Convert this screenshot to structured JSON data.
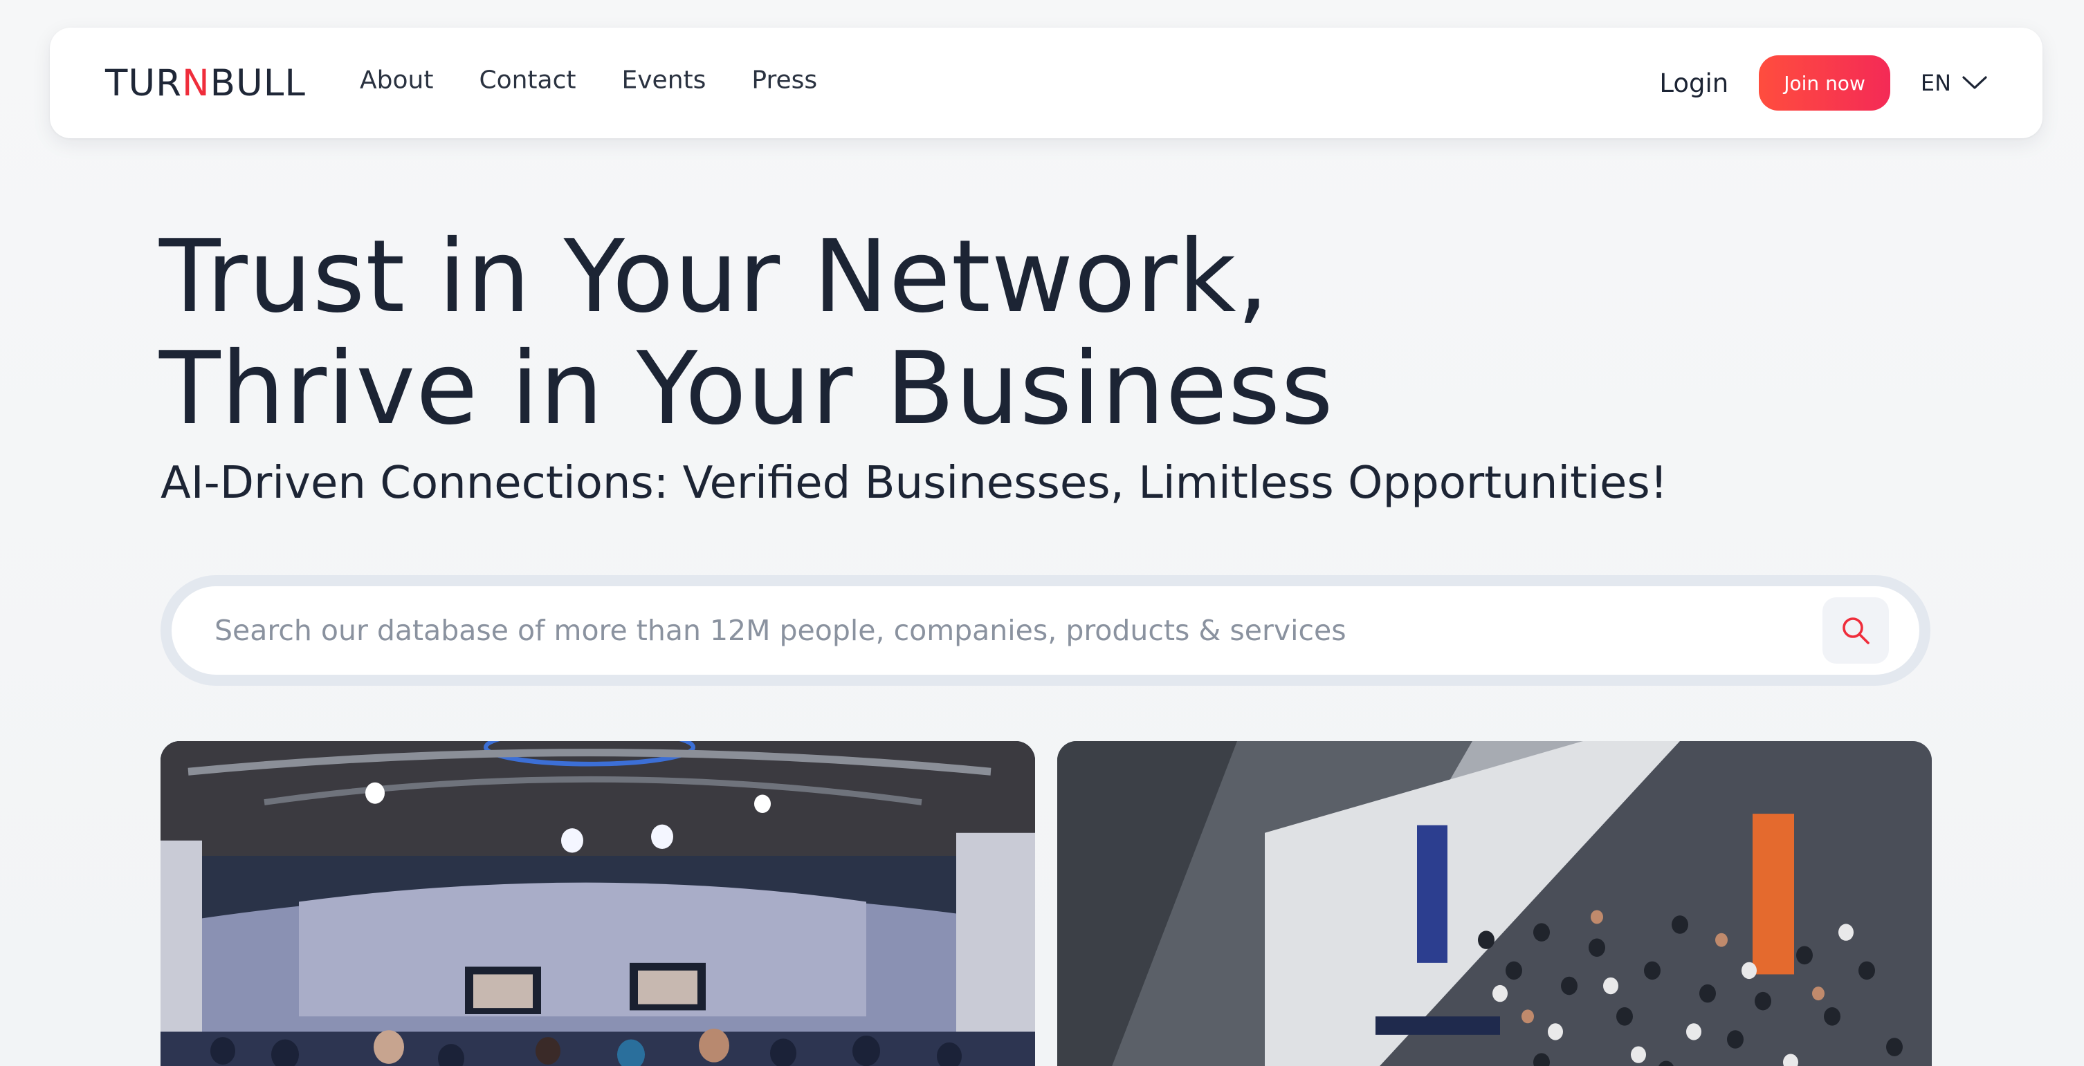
{
  "header": {
    "logo": {
      "part1": "TUR",
      "accent": "N",
      "part2": "BULL"
    },
    "nav": [
      {
        "label": "About"
      },
      {
        "label": "Contact"
      },
      {
        "label": "Events"
      },
      {
        "label": "Press"
      }
    ],
    "login_label": "Login",
    "join_label": "Join now",
    "language": "EN"
  },
  "hero": {
    "title_line1": "Trust in Your Network,",
    "title_line2": "Thrive in Your Business",
    "subtitle": "AI-Driven Connections: Verified Businesses, Limitless Opportunities!"
  },
  "search": {
    "placeholder": "Search our database of more than 12M people, companies, products & services",
    "value": ""
  },
  "photos": [
    {
      "icon": "conference-stage-photo"
    },
    {
      "icon": "crowd-expo-photo"
    }
  ],
  "colors": {
    "accent": "#ef2d3b",
    "join_gradient_start": "#ff4d3e",
    "join_gradient_end": "#f42a56",
    "text": "#1c2434"
  }
}
